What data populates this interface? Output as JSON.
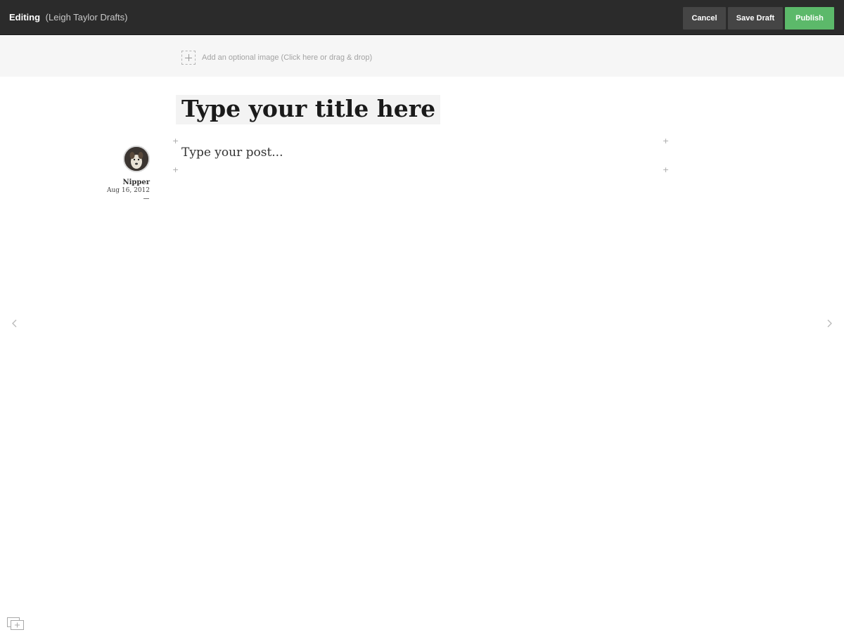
{
  "header": {
    "editing_label": "Editing",
    "collection_label": "(Leigh Taylor Drafts)",
    "cancel_label": "Cancel",
    "save_draft_label": "Save Draft",
    "publish_label": "Publish",
    "publish_color": "#5cb96a"
  },
  "image_upload": {
    "label": "Add an optional image (Click here or drag & drop)",
    "icon": "add-image-icon"
  },
  "post": {
    "title_placeholder": "Type your title here",
    "body_placeholder": "Type your post..."
  },
  "author": {
    "name": "Nipper",
    "date": "Aug 16, 2012"
  },
  "icons": {
    "prev": "chevron-left-icon",
    "next": "chevron-right-icon",
    "gallery": "add-gallery-icon",
    "insert": "plus-icon"
  }
}
